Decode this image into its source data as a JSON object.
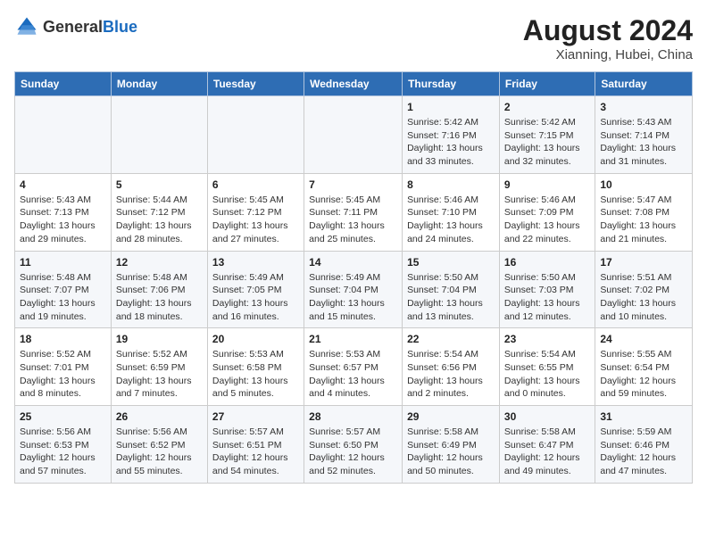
{
  "header": {
    "logo_general": "General",
    "logo_blue": "Blue",
    "month_year": "August 2024",
    "location": "Xianning, Hubei, China"
  },
  "weekdays": [
    "Sunday",
    "Monday",
    "Tuesday",
    "Wednesday",
    "Thursday",
    "Friday",
    "Saturday"
  ],
  "weeks": [
    [
      {
        "day": "",
        "sunrise": "",
        "sunset": "",
        "daylight": ""
      },
      {
        "day": "",
        "sunrise": "",
        "sunset": "",
        "daylight": ""
      },
      {
        "day": "",
        "sunrise": "",
        "sunset": "",
        "daylight": ""
      },
      {
        "day": "",
        "sunrise": "",
        "sunset": "",
        "daylight": ""
      },
      {
        "day": "1",
        "sunrise": "Sunrise: 5:42 AM",
        "sunset": "Sunset: 7:16 PM",
        "daylight": "Daylight: 13 hours and 33 minutes."
      },
      {
        "day": "2",
        "sunrise": "Sunrise: 5:42 AM",
        "sunset": "Sunset: 7:15 PM",
        "daylight": "Daylight: 13 hours and 32 minutes."
      },
      {
        "day": "3",
        "sunrise": "Sunrise: 5:43 AM",
        "sunset": "Sunset: 7:14 PM",
        "daylight": "Daylight: 13 hours and 31 minutes."
      }
    ],
    [
      {
        "day": "4",
        "sunrise": "Sunrise: 5:43 AM",
        "sunset": "Sunset: 7:13 PM",
        "daylight": "Daylight: 13 hours and 29 minutes."
      },
      {
        "day": "5",
        "sunrise": "Sunrise: 5:44 AM",
        "sunset": "Sunset: 7:12 PM",
        "daylight": "Daylight: 13 hours and 28 minutes."
      },
      {
        "day": "6",
        "sunrise": "Sunrise: 5:45 AM",
        "sunset": "Sunset: 7:12 PM",
        "daylight": "Daylight: 13 hours and 27 minutes."
      },
      {
        "day": "7",
        "sunrise": "Sunrise: 5:45 AM",
        "sunset": "Sunset: 7:11 PM",
        "daylight": "Daylight: 13 hours and 25 minutes."
      },
      {
        "day": "8",
        "sunrise": "Sunrise: 5:46 AM",
        "sunset": "Sunset: 7:10 PM",
        "daylight": "Daylight: 13 hours and 24 minutes."
      },
      {
        "day": "9",
        "sunrise": "Sunrise: 5:46 AM",
        "sunset": "Sunset: 7:09 PM",
        "daylight": "Daylight: 13 hours and 22 minutes."
      },
      {
        "day": "10",
        "sunrise": "Sunrise: 5:47 AM",
        "sunset": "Sunset: 7:08 PM",
        "daylight": "Daylight: 13 hours and 21 minutes."
      }
    ],
    [
      {
        "day": "11",
        "sunrise": "Sunrise: 5:48 AM",
        "sunset": "Sunset: 7:07 PM",
        "daylight": "Daylight: 13 hours and 19 minutes."
      },
      {
        "day": "12",
        "sunrise": "Sunrise: 5:48 AM",
        "sunset": "Sunset: 7:06 PM",
        "daylight": "Daylight: 13 hours and 18 minutes."
      },
      {
        "day": "13",
        "sunrise": "Sunrise: 5:49 AM",
        "sunset": "Sunset: 7:05 PM",
        "daylight": "Daylight: 13 hours and 16 minutes."
      },
      {
        "day": "14",
        "sunrise": "Sunrise: 5:49 AM",
        "sunset": "Sunset: 7:04 PM",
        "daylight": "Daylight: 13 hours and 15 minutes."
      },
      {
        "day": "15",
        "sunrise": "Sunrise: 5:50 AM",
        "sunset": "Sunset: 7:04 PM",
        "daylight": "Daylight: 13 hours and 13 minutes."
      },
      {
        "day": "16",
        "sunrise": "Sunrise: 5:50 AM",
        "sunset": "Sunset: 7:03 PM",
        "daylight": "Daylight: 13 hours and 12 minutes."
      },
      {
        "day": "17",
        "sunrise": "Sunrise: 5:51 AM",
        "sunset": "Sunset: 7:02 PM",
        "daylight": "Daylight: 13 hours and 10 minutes."
      }
    ],
    [
      {
        "day": "18",
        "sunrise": "Sunrise: 5:52 AM",
        "sunset": "Sunset: 7:01 PM",
        "daylight": "Daylight: 13 hours and 8 minutes."
      },
      {
        "day": "19",
        "sunrise": "Sunrise: 5:52 AM",
        "sunset": "Sunset: 6:59 PM",
        "daylight": "Daylight: 13 hours and 7 minutes."
      },
      {
        "day": "20",
        "sunrise": "Sunrise: 5:53 AM",
        "sunset": "Sunset: 6:58 PM",
        "daylight": "Daylight: 13 hours and 5 minutes."
      },
      {
        "day": "21",
        "sunrise": "Sunrise: 5:53 AM",
        "sunset": "Sunset: 6:57 PM",
        "daylight": "Daylight: 13 hours and 4 minutes."
      },
      {
        "day": "22",
        "sunrise": "Sunrise: 5:54 AM",
        "sunset": "Sunset: 6:56 PM",
        "daylight": "Daylight: 13 hours and 2 minutes."
      },
      {
        "day": "23",
        "sunrise": "Sunrise: 5:54 AM",
        "sunset": "Sunset: 6:55 PM",
        "daylight": "Daylight: 13 hours and 0 minutes."
      },
      {
        "day": "24",
        "sunrise": "Sunrise: 5:55 AM",
        "sunset": "Sunset: 6:54 PM",
        "daylight": "Daylight: 12 hours and 59 minutes."
      }
    ],
    [
      {
        "day": "25",
        "sunrise": "Sunrise: 5:56 AM",
        "sunset": "Sunset: 6:53 PM",
        "daylight": "Daylight: 12 hours and 57 minutes."
      },
      {
        "day": "26",
        "sunrise": "Sunrise: 5:56 AM",
        "sunset": "Sunset: 6:52 PM",
        "daylight": "Daylight: 12 hours and 55 minutes."
      },
      {
        "day": "27",
        "sunrise": "Sunrise: 5:57 AM",
        "sunset": "Sunset: 6:51 PM",
        "daylight": "Daylight: 12 hours and 54 minutes."
      },
      {
        "day": "28",
        "sunrise": "Sunrise: 5:57 AM",
        "sunset": "Sunset: 6:50 PM",
        "daylight": "Daylight: 12 hours and 52 minutes."
      },
      {
        "day": "29",
        "sunrise": "Sunrise: 5:58 AM",
        "sunset": "Sunset: 6:49 PM",
        "daylight": "Daylight: 12 hours and 50 minutes."
      },
      {
        "day": "30",
        "sunrise": "Sunrise: 5:58 AM",
        "sunset": "Sunset: 6:47 PM",
        "daylight": "Daylight: 12 hours and 49 minutes."
      },
      {
        "day": "31",
        "sunrise": "Sunrise: 5:59 AM",
        "sunset": "Sunset: 6:46 PM",
        "daylight": "Daylight: 12 hours and 47 minutes."
      }
    ]
  ]
}
